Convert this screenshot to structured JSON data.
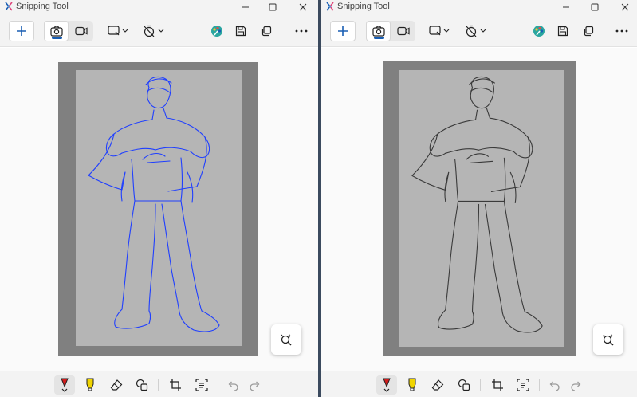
{
  "left_window": {
    "title": "Snipping Tool",
    "image_tint": "#1f3fff"
  },
  "right_window": {
    "title": "Snipping Tool",
    "image_tint": "#3a3a3a"
  },
  "colors": {
    "accent": "#1a5fb4",
    "frame": "#808080",
    "paper": "#b5b5b5",
    "pen_red": "#d21d1d",
    "highlighter_yellow": "#f0d400"
  },
  "icons": {
    "app": "snipping-tool-icon",
    "minimize": "minimize-icon",
    "maximize": "maximize-icon",
    "close": "close-icon",
    "new": "plus-icon",
    "screenshot_mode": "camera-icon",
    "video_mode": "video-camera-icon",
    "snip_shape": "rectangle-snip-icon",
    "delay": "timer-off-icon",
    "edit_in_paint": "paint-palette-icon",
    "save": "save-icon",
    "copy": "copy-icon",
    "more": "more-horizontal-icon",
    "visual_search": "visual-search-icon",
    "ballpoint_pen": "ballpoint-pen-icon",
    "highlighter": "highlighter-icon",
    "eraser": "eraser-icon",
    "shapes": "shapes-icon",
    "crop": "crop-icon",
    "text_actions": "text-actions-icon",
    "undo": "undo-icon",
    "redo": "redo-icon"
  }
}
